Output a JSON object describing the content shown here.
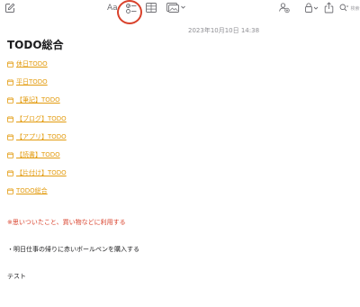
{
  "toolbar": {
    "format_label": "Aa",
    "search_placeholder": "検索",
    "icons": [
      "compose-icon",
      "checklist-icon",
      "table-icon",
      "media-icon",
      "collaborate-icon",
      "lock-icon",
      "share-icon",
      "search-icon"
    ],
    "highlight_color": "#d9412b"
  },
  "note": {
    "date": "2023年10月10日 14:38",
    "title": "TODO総合",
    "links": [
      {
        "label": "休日TODO"
      },
      {
        "label": "平日TODO"
      },
      {
        "label": "【筆記】TODO"
      },
      {
        "label": "【ブログ】TODO"
      },
      {
        "label": "【アプリ】TODO"
      },
      {
        "label": "【読書】TODO"
      },
      {
        "label": "【片付け】TODO"
      },
      {
        "label": "TODO総合"
      }
    ],
    "link_color": "#e39b0e",
    "red_note": "※思いついたこと、買い物などに利用する",
    "red_note_color": "#d9412b",
    "bullet_line": "・明日仕事の帰りに赤いボールペンを購入する",
    "test_line": "テスト"
  }
}
